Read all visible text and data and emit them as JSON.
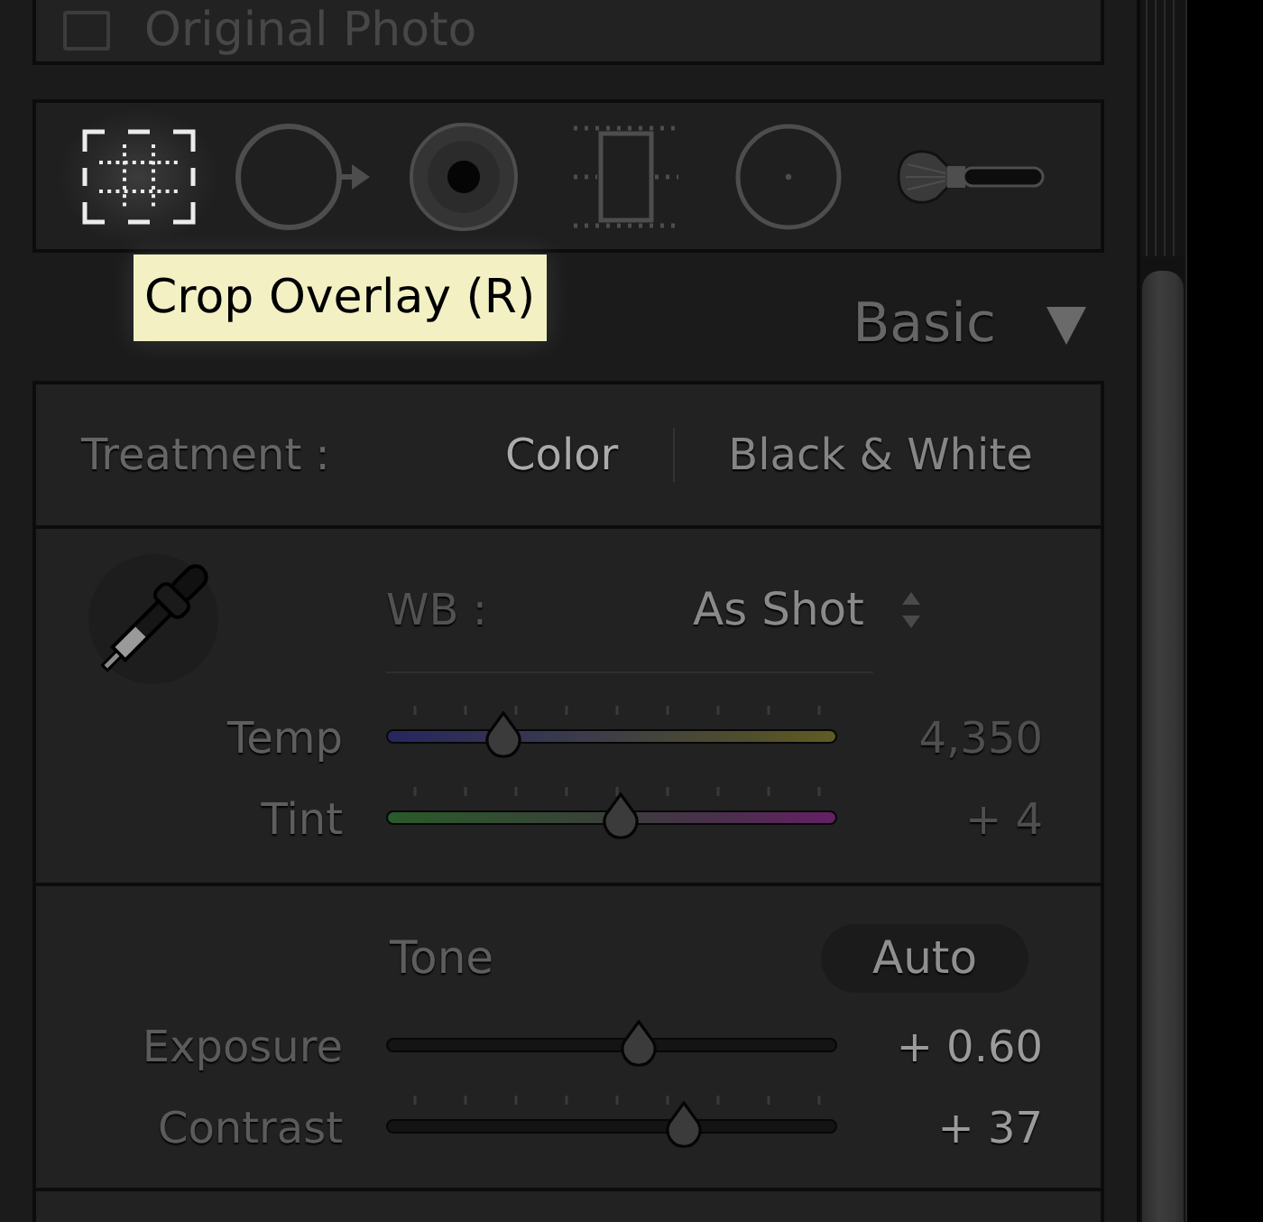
{
  "original_photo": {
    "label": "Original Photo",
    "checked": false
  },
  "tools": [
    {
      "kind": "crop",
      "selected": true
    },
    {
      "kind": "spot",
      "selected": false
    },
    {
      "kind": "redeye",
      "selected": false
    },
    {
      "kind": "graduated",
      "selected": false
    },
    {
      "kind": "radial",
      "selected": false
    },
    {
      "kind": "brush",
      "selected": false
    }
  ],
  "tooltip": "Crop Overlay (R)",
  "panel": {
    "title": "Basic",
    "expanded": true
  },
  "treatment": {
    "label": "Treatment :",
    "options": [
      {
        "label": "Color",
        "selected": true
      },
      {
        "label": "Black & White",
        "selected": false
      }
    ]
  },
  "white_balance": {
    "label": "WB :",
    "value": "As Shot",
    "sliders": [
      {
        "kind": "temp",
        "label": "Temp",
        "level": 0.26,
        "value": "4,350",
        "ticks": true
      },
      {
        "kind": "tint",
        "label": "Tint",
        "level": 0.52,
        "value": "+ 4",
        "ticks": true
      }
    ]
  },
  "tone": {
    "title": "Tone",
    "auto_button": "Auto",
    "sliders": [
      {
        "kind": "plain",
        "label": "Exposure",
        "level": 0.56,
        "value": "+ 0.60",
        "ticks": false
      },
      {
        "kind": "plain",
        "label": "Contrast",
        "level": 0.66,
        "value": "+ 37",
        "ticks": true
      }
    ]
  }
}
